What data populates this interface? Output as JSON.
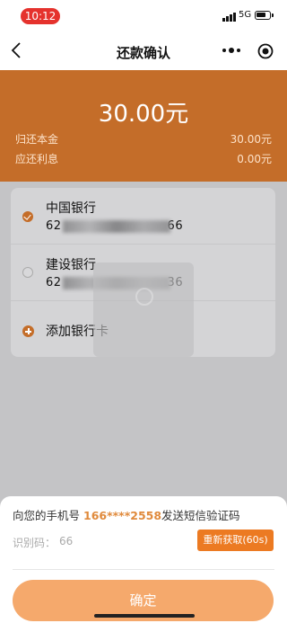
{
  "status_bar": {
    "time": "10:12",
    "network": "5G"
  },
  "nav": {
    "title": "还款确认"
  },
  "summary": {
    "amount": "30.00元",
    "principal_label": "归还本金",
    "principal_value": "30.00元",
    "interest_label": "应还利息",
    "interest_value": "0.00元"
  },
  "cards": [
    {
      "bank": "中国银行",
      "number_prefix": "62",
      "number_suffix": "66",
      "selected": true
    },
    {
      "bank": "建设银行",
      "number_prefix": "62",
      "number_suffix": "36",
      "selected": false
    }
  ],
  "add_card_label": "添加银行卡",
  "sms": {
    "prefix": "向您的手机号",
    "phone": "166****2558",
    "suffix": "发送短信验证码",
    "code_label": "识别码：",
    "code_value": "66",
    "resend_label": "重新获取(60s)"
  },
  "confirm_label": "确定",
  "colors": {
    "accent": "#c46d29",
    "button_orange": "#ec7a22",
    "confirm_bg": "#f5a96c",
    "phone_text": "#e08a3c"
  },
  "icons": [
    "back-icon",
    "more-icon",
    "target-icon",
    "check-icon",
    "plus-icon",
    "signal-icon",
    "battery-icon"
  ]
}
